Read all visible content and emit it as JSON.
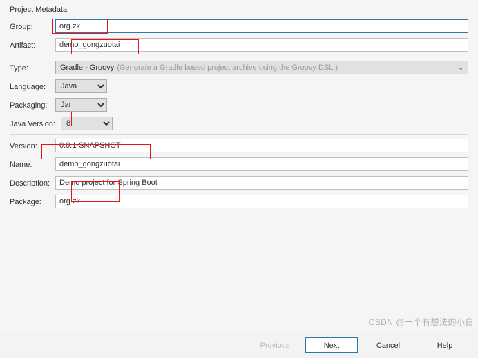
{
  "sectionTitle": "Project Metadata",
  "labels": {
    "group": "Group:",
    "artifact": "Artifact:",
    "type": "Type:",
    "language": "Language:",
    "packaging": "Packaging:",
    "javaVersion": "Java Version:",
    "version": "Version:",
    "name": "Name:",
    "description": "Description:",
    "package": "Package:"
  },
  "values": {
    "group": "org.zk",
    "artifact": "demo_gongzuotai",
    "typeSelected": "Gradle - Groovy",
    "typeHint": "(Generate a Gradle based project archive using the Groovy DSL.)",
    "language": "Java",
    "packaging": "Jar",
    "javaVersion": "8",
    "version": "0.0.1-SNAPSHOT",
    "name": "demo_gongzuotai",
    "description": "Demo project for Spring Boot",
    "package": "org.zk"
  },
  "buttons": {
    "previous": "Previous",
    "next": "Next",
    "cancel": "Cancel",
    "help": "Help"
  },
  "watermark": "CSDN @一个有想法的小白"
}
